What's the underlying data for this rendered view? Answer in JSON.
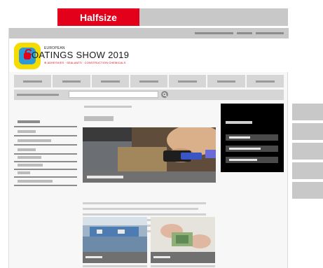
{
  "banner": {
    "label": "Halfsize",
    "accent_color": "#e2001a"
  },
  "logo": {
    "small_text": "EUROPEAN",
    "title_c": "C",
    "title_rest": "OATINGS SHOW 2019",
    "subtitle": "⊕ ADHESIVES · SEALANTS · CONSTRUCTION CHEMICALS",
    "colors": {
      "yellow": "#f5dc00",
      "blue": "#2a9bd6",
      "red": "#e2001a"
    }
  },
  "search": {
    "button_icon": "search-icon",
    "placeholder": ""
  },
  "icons": {
    "search": "search-icon"
  }
}
